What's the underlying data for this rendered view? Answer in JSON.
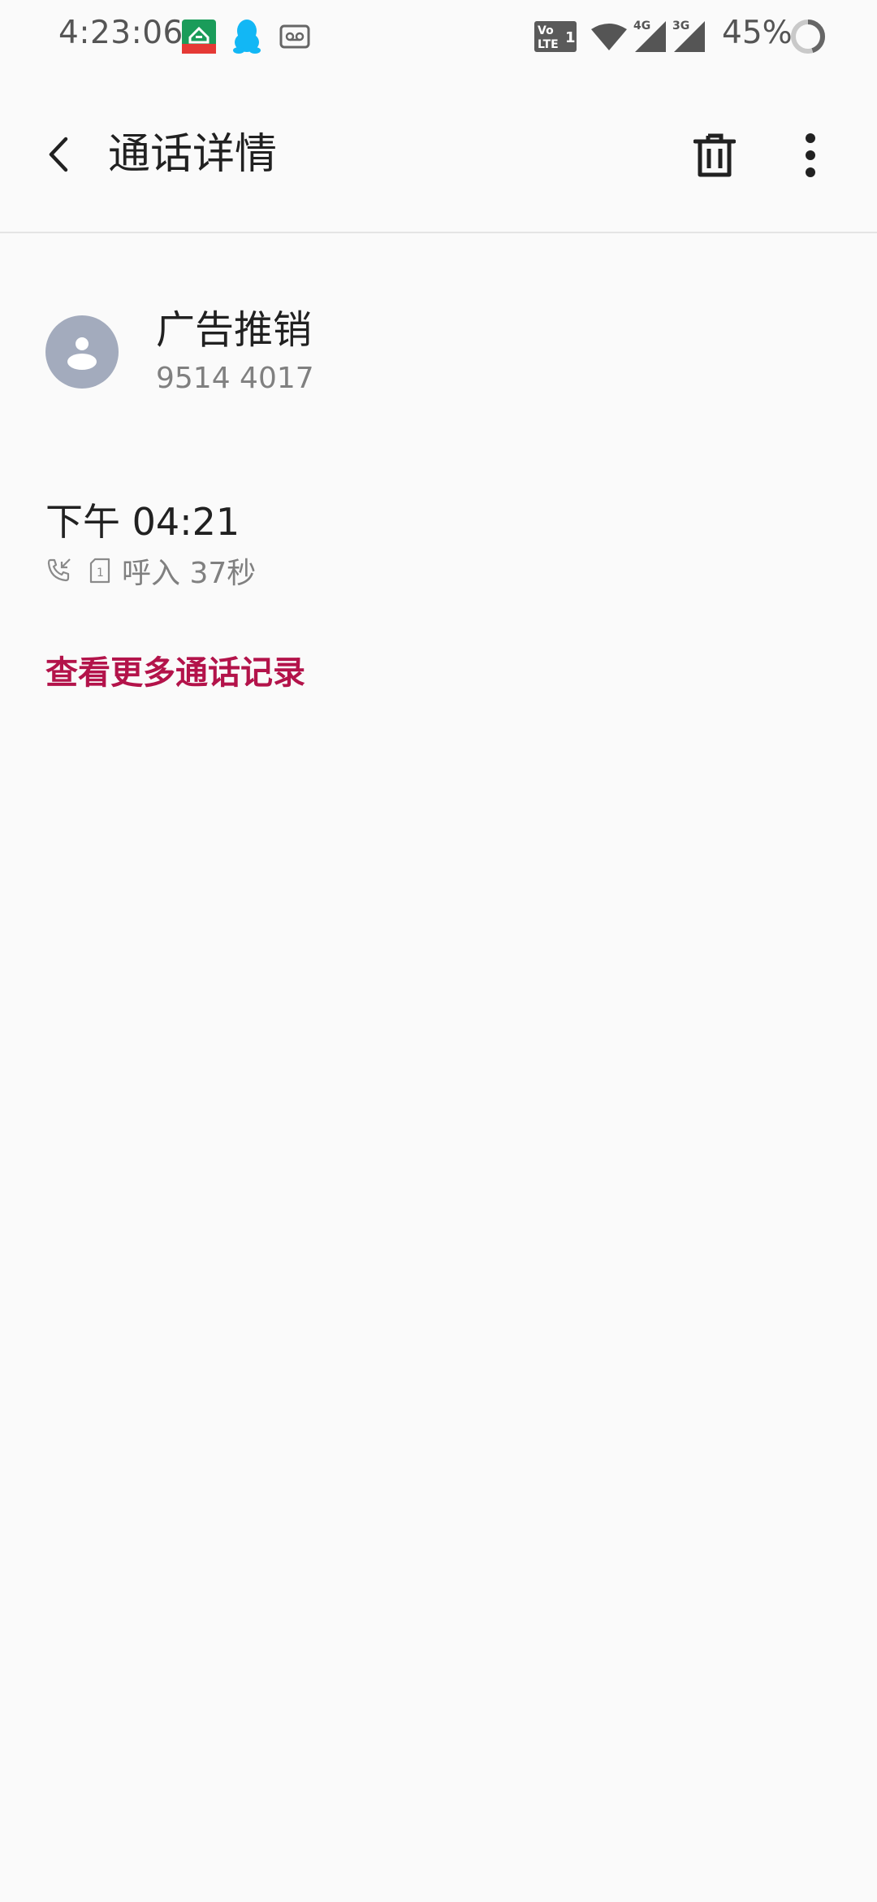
{
  "status_bar": {
    "time": "4:23:06",
    "battery_percent": "45%",
    "battery_level": 0.45,
    "icons": [
      "qq-browser-icon",
      "qq-icon",
      "voicemail-icon",
      "volte-icon",
      "wifi-icon",
      "signal-4g-icon",
      "signal-3g-icon",
      "battery-icon"
    ],
    "network_labels": {
      "volte": "Vo LTE 1",
      "sim1": "4G",
      "sim2": "3G"
    }
  },
  "app_bar": {
    "title": "通话详情"
  },
  "contact": {
    "name": "广告推销",
    "number": "9514 4017"
  },
  "call": {
    "time": "下午 04:21",
    "sim": "1",
    "type_duration": "呼入 37秒"
  },
  "links": {
    "more_history": "查看更多通话记录"
  },
  "colors": {
    "accent": "#b3134a",
    "avatar_bg": "#a3abbd",
    "background": "#fafafa"
  }
}
